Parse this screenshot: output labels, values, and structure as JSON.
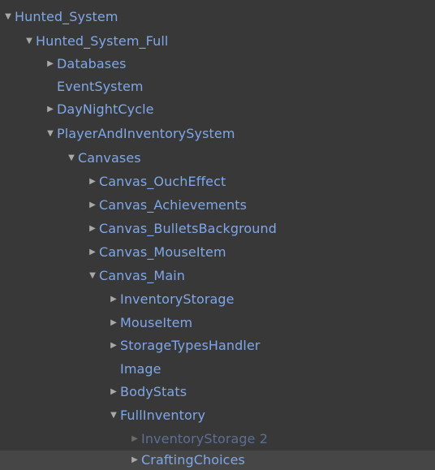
{
  "hierarchy": {
    "items": [
      {
        "label": "Hunted_System",
        "arrow": "▼"
      },
      {
        "label": "Hunted_System_Full",
        "arrow": "▼"
      },
      {
        "label": "Databases",
        "arrow": "▶"
      },
      {
        "label": "EventSystem",
        "arrow": ""
      },
      {
        "label": "DayNightCycle",
        "arrow": "▶"
      },
      {
        "label": "PlayerAndInventorySystem",
        "arrow": "▼"
      },
      {
        "label": "Canvases",
        "arrow": "▼"
      },
      {
        "label": "Canvas_OuchEffect",
        "arrow": "▶"
      },
      {
        "label": "Canvas_Achievements",
        "arrow": "▶"
      },
      {
        "label": "Canvas_BulletsBackground",
        "arrow": "▶"
      },
      {
        "label": "Canvas_MouseItem",
        "arrow": "▶"
      },
      {
        "label": "Canvas_Main",
        "arrow": "▼"
      },
      {
        "label": "InventoryStorage",
        "arrow": "▶"
      },
      {
        "label": "MouseItem",
        "arrow": "▶"
      },
      {
        "label": "StorageTypesHandler",
        "arrow": "▶"
      },
      {
        "label": "Image",
        "arrow": ""
      },
      {
        "label": "BodyStats",
        "arrow": "▶"
      },
      {
        "label": "FullInventory",
        "arrow": "▼"
      },
      {
        "label": "InventoryStorage 2",
        "arrow": "▶"
      },
      {
        "label": "CraftingChoices",
        "arrow": "▶"
      }
    ]
  },
  "colors": {
    "background": "#383838",
    "selected_row": "#464646",
    "label": "#7fa7e8",
    "disabled_label": "#5c6f93",
    "arrow": "#a8a8a8"
  }
}
